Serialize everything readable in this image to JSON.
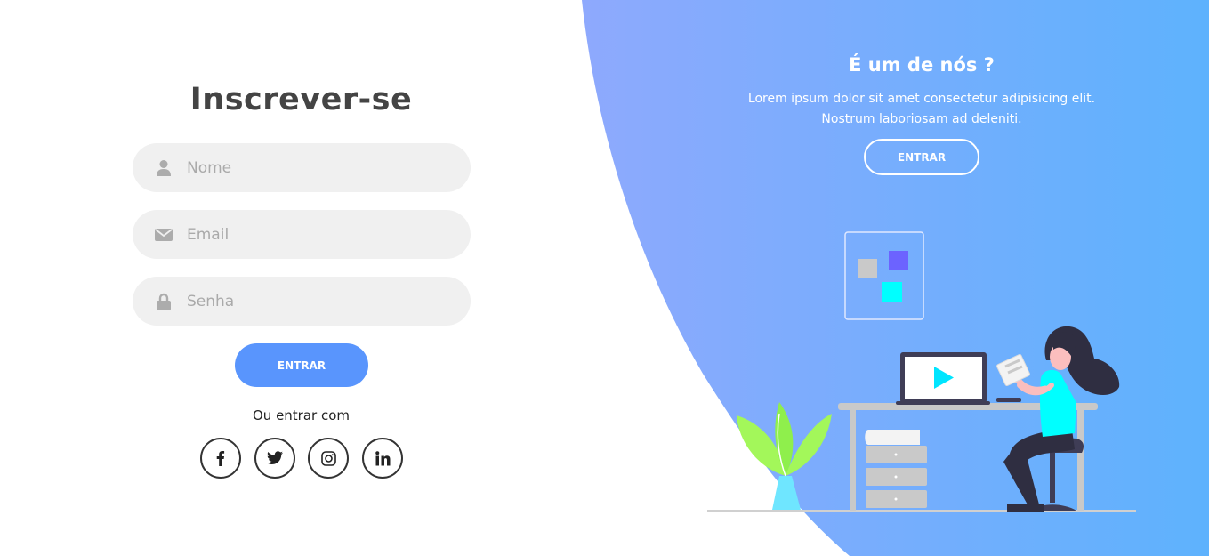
{
  "signup": {
    "title": "Inscrever-se",
    "name_placeholder": "Nome",
    "email_placeholder": "Email",
    "password_placeholder": "Senha",
    "submit_label": "ENTRAR",
    "social_text": "Ou entrar com",
    "social_icons": [
      "facebook-icon",
      "twitter-icon",
      "instagram-icon",
      "linkedin-icon"
    ]
  },
  "panel": {
    "title": "É um de nós ?",
    "text_line1": "Lorem ipsum dolor sit amet consectetur adipisicing elit.",
    "text_line2": "Nostrum laboriosam ad deleniti.",
    "button_label": "ENTRAR"
  },
  "colors": {
    "primary": "#5995fd",
    "gradient_start": "#8ea9fd",
    "gradient_end": "#5eb2fd",
    "field_bg": "#f0f0f0",
    "title": "#444444"
  }
}
